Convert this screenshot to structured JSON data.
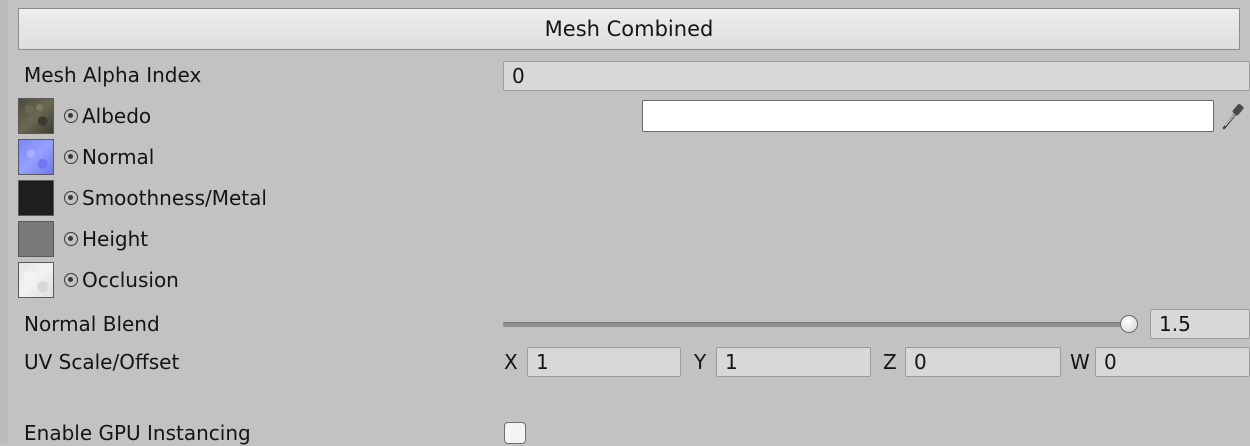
{
  "header": {
    "title": "Mesh Combined"
  },
  "mesh_alpha_index": {
    "label": "Mesh Alpha Index",
    "value": "0"
  },
  "textures": [
    {
      "label": "Albedo",
      "swatch_icon": "albedo-texture-thumbnail"
    },
    {
      "label": "Normal",
      "swatch_icon": "normal-map-thumbnail"
    },
    {
      "label": "Smoothness/Metal",
      "swatch_icon": "smoothness-metal-thumbnail"
    },
    {
      "label": "Height",
      "swatch_icon": "height-map-thumbnail"
    },
    {
      "label": "Occlusion",
      "swatch_icon": "occlusion-map-thumbnail"
    }
  ],
  "albedo_color": {
    "value": "#ffffff",
    "picker_icon": "eyedropper-icon"
  },
  "normal_blend": {
    "label": "Normal Blend",
    "value": "1.5"
  },
  "uv_scale_offset": {
    "label": "UV Scale/Offset",
    "x_label": "X",
    "x": "1",
    "y_label": "Y",
    "y": "1",
    "z_label": "Z",
    "z": "0",
    "w_label": "W",
    "w": "0"
  },
  "gpu_instancing": {
    "label": "Enable GPU Instancing",
    "checked": false
  },
  "colors": {
    "panel_bg": "#c2c2c2",
    "field_bg": "#d8d8d8",
    "header_bg": "#e6e6e6"
  }
}
